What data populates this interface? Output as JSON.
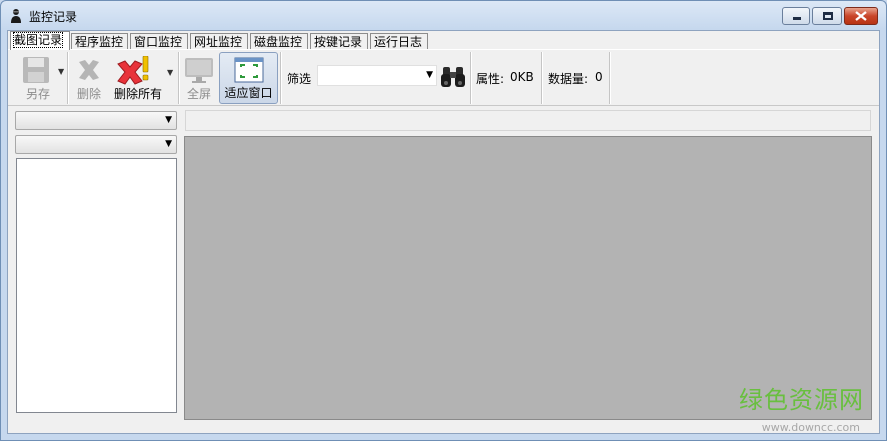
{
  "window": {
    "title": "监控记录",
    "close_color": "#c9452a"
  },
  "tabs": [
    {
      "label": "截图记录",
      "active": true
    },
    {
      "label": "程序监控"
    },
    {
      "label": "窗口监控"
    },
    {
      "label": "网址监控"
    },
    {
      "label": "磁盘监控"
    },
    {
      "label": "按键记录"
    },
    {
      "label": "运行日志"
    }
  ],
  "toolbar": {
    "save_as": "另存",
    "delete": "删除",
    "delete_all": "删除所有",
    "fullscreen": "全屏",
    "fit_window": "适应窗口",
    "filter_label": "筛选",
    "filter_value": "",
    "attr_label": "属性:",
    "attr_value": "0KB",
    "count_label": "数据量:",
    "count_value": "0"
  },
  "watermark": {
    "text": "绿色资源网",
    "url": "www.downcc.com",
    "color": "#69bf3f"
  }
}
